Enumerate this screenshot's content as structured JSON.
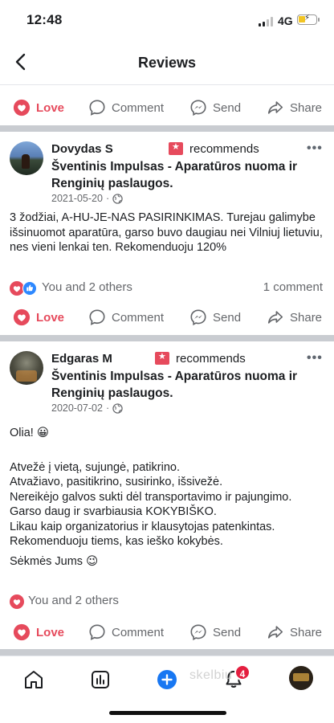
{
  "status_bar": {
    "time": "12:48",
    "network": "4G",
    "battery_level": 0.35
  },
  "header": {
    "title": "Reviews"
  },
  "actions": {
    "love": "Love",
    "comment": "Comment",
    "send": "Send",
    "share": "Share"
  },
  "posts": [
    {
      "author": "Dovydas S",
      "recommends": "recommends",
      "page_name": "Šventinis Impulsas - Aparatūros nuoma ir Renginių paslaugos.",
      "date": "2021-05-20",
      "text": "3 žodžiai, A-HU-JE-NAS PASIRINKIMAS. Turejau galimybe išsinuomot aparatūra, garso buvo daugiau nei Vilniuj lietuviu, nes vieni lenkai ten. Rekomenduoju 120%",
      "reactions": "You and 2 others",
      "comments": "1 comment"
    },
    {
      "author": "Edgaras M",
      "recommends": "recommends",
      "page_name": "Šventinis Impulsas - Aparatūros nuoma ir Renginių paslaugos.",
      "date": "2020-07-02",
      "text_lines": [
        "Olia! 😀",
        "",
        "Atvežė į vietą, sujungė, patikrino.\nAtvažiavo, pasitikrino, susirinko, išsivežė.\nNereikėjo galvos sukti dėl transportavimo ir pajungimo.\nGarso daug ir svarbiausia KOKYBIŠKO.\nLikau kaip organizatorius ir klausytojas patenkintas.\nRekomenduoju tiems, kas ieško kokybės.",
        "Sėkmės Jums 😉"
      ],
      "reactions": "You and 2 others"
    }
  ],
  "bottom_nav": {
    "notifications_badge": "4",
    "icons": [
      "home-icon",
      "dashboard-icon",
      "create-icon",
      "notifications-icon",
      "profile-icon"
    ]
  },
  "watermark": "skelbiu",
  "colors": {
    "love": "#e64a5c",
    "muted": "#65676b",
    "like_blue": "#2d88ff",
    "create_blue": "#1877f2",
    "badge_red": "#e41e3f"
  }
}
